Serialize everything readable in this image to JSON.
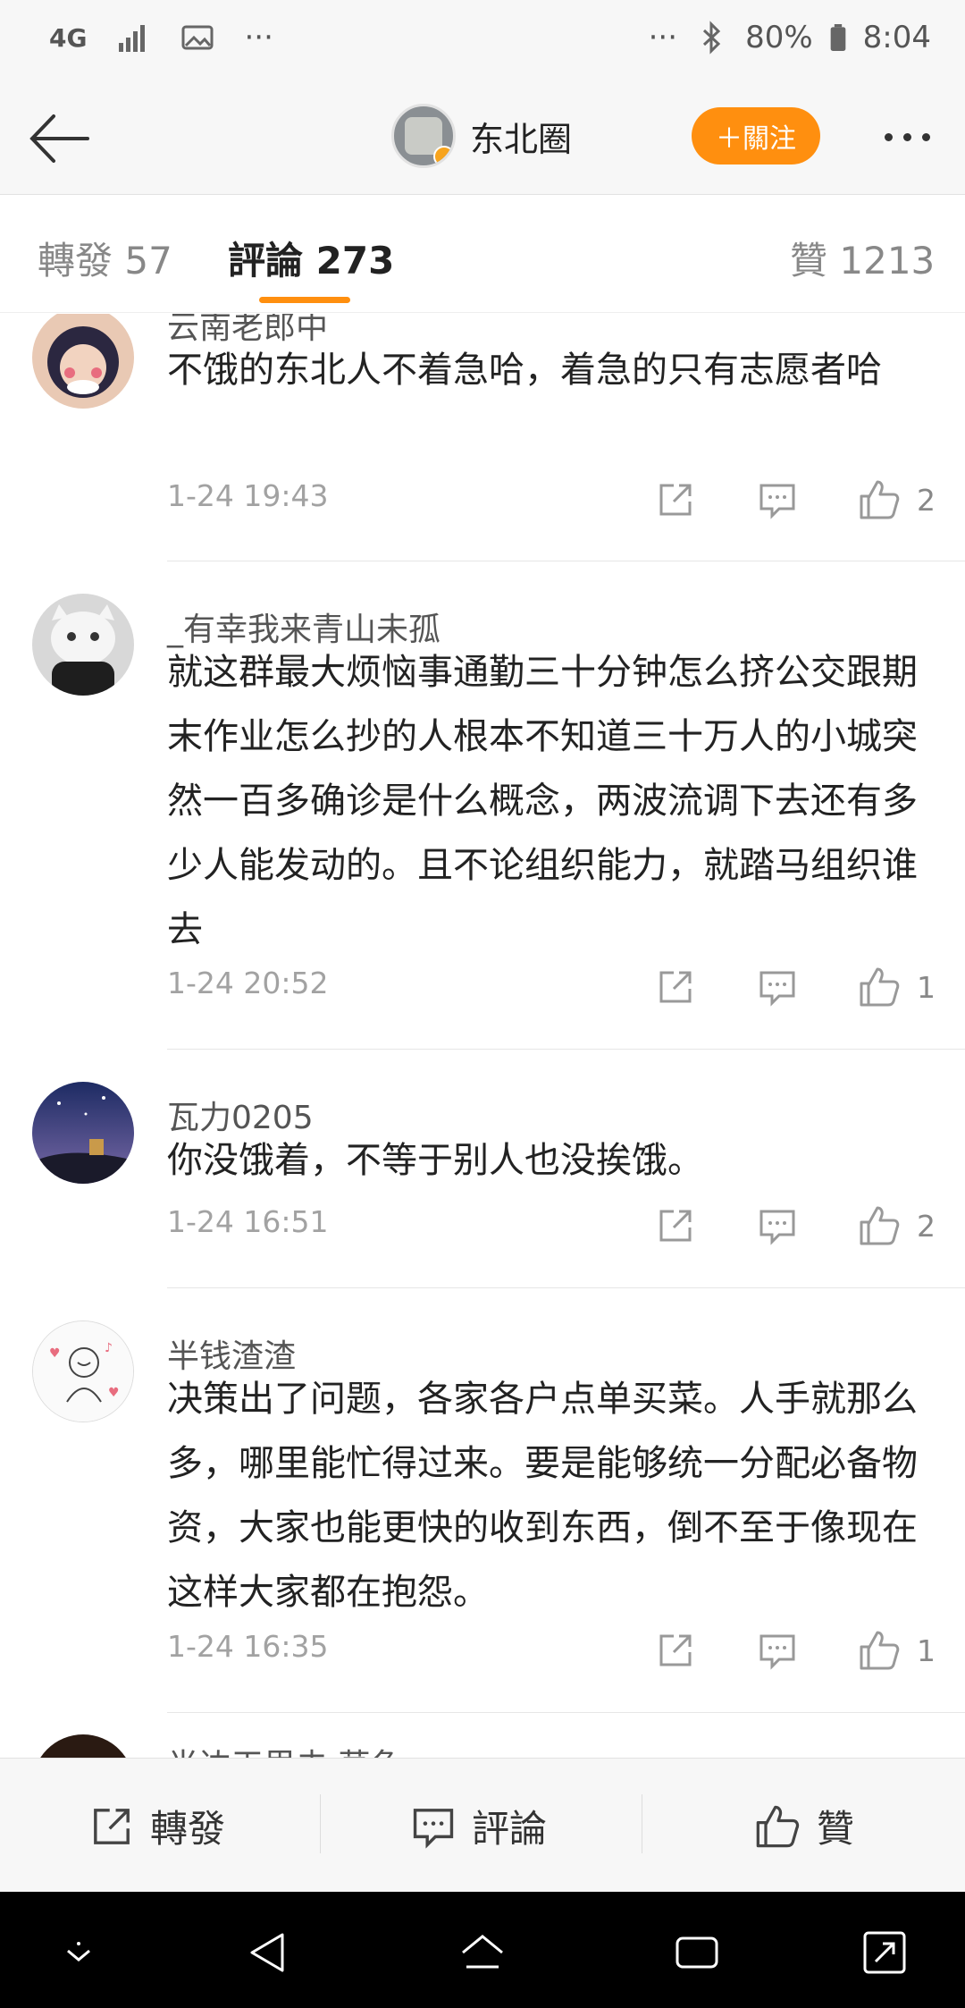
{
  "status_bar": {
    "network": "4G",
    "battery": "80%",
    "time": "8:04",
    "more_left": "···",
    "more_right": "···"
  },
  "header": {
    "back_icon": "arrow-left-icon",
    "title": "东北圈",
    "follow_label": "＋關注",
    "more_icon": "more-dots-icon"
  },
  "tabs": [
    {
      "label": "轉發",
      "count": "57"
    },
    {
      "label": "評論",
      "count": "273"
    },
    {
      "label": "贊",
      "count": "1213"
    }
  ],
  "comments": [
    {
      "username": "云南老郎中",
      "text": "不饿的东北人不着急哈，着急的只有志愿者哈",
      "time": "1-24 19:43",
      "likes": "2"
    },
    {
      "username": "_有幸我来青山未孤",
      "text": "就这群最大烦恼事通勤三十分钟怎么挤公交跟期末作业怎么抄的人根本不知道三十万人的小城突然一百多确诊是什么概念，两波流调下去还有多少人能发动的。且不论组织能力，就踏马组织谁去",
      "time": "1-24 20:52",
      "likes": "1"
    },
    {
      "username": "瓦力0205",
      "text": "你没饿着，不等于别人也没挨饿。",
      "time": "1-24 16:51",
      "likes": "2"
    },
    {
      "username": "半钱渣渣",
      "text": "决策出了问题，各家各户点单买菜。人手就那么多，哪里能忙得过来。要是能够统一分配必备物资，大家也能更快的收到东西，倒不至于像现在这样大家都在抱怨。",
      "time": "1-24 16:35",
      "likes": "1"
    },
    {
      "username": "半边天里去 草鱼"
    }
  ],
  "bottom_bar": {
    "repost_label": "轉發",
    "comment_label": "評論",
    "like_label": "贊"
  },
  "colors": {
    "accent": "#ff8f0f",
    "text_primary": "#222222",
    "text_secondary": "#a2a2a2"
  }
}
